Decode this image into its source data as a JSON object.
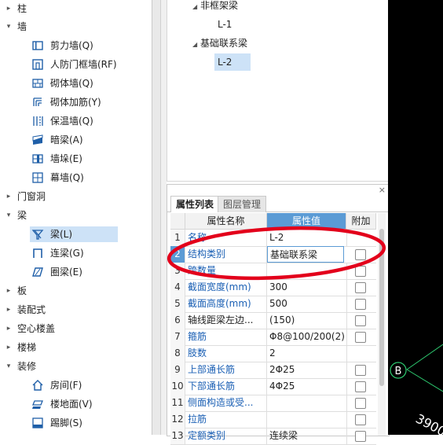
{
  "left_tree": {
    "categories": [
      {
        "label": "柱",
        "expanded": false
      },
      {
        "label": "墙",
        "expanded": true
      },
      {
        "label": "门窗洞",
        "expanded": false
      },
      {
        "label": "梁",
        "expanded": true
      },
      {
        "label": "板",
        "expanded": false
      },
      {
        "label": "装配式",
        "expanded": false
      },
      {
        "label": "空心楼盖",
        "expanded": false
      },
      {
        "label": "楼梯",
        "expanded": false
      },
      {
        "label": "装修",
        "expanded": true
      }
    ],
    "wall_items": [
      {
        "label": "剪力墙(Q)",
        "icon": "shear-wall-icon"
      },
      {
        "label": "人防门框墙(RF)",
        "icon": "civil-defense-door-wall-icon"
      },
      {
        "label": "砌体墙(Q)",
        "icon": "masonry-wall-icon"
      },
      {
        "label": "砌体加筋(Y)",
        "icon": "masonry-rebar-icon"
      },
      {
        "label": "保温墙(Q)",
        "icon": "insulation-wall-icon"
      },
      {
        "label": "暗梁(A)",
        "icon": "hidden-beam-icon"
      },
      {
        "label": "墙垛(E)",
        "icon": "wall-pier-icon"
      },
      {
        "label": "幕墙(Q)",
        "icon": "curtain-wall-icon"
      }
    ],
    "beam_items": [
      {
        "label": "梁(L)",
        "icon": "beam-icon",
        "selected": true
      },
      {
        "label": "连梁(G)",
        "icon": "coupling-beam-icon",
        "selected": false
      },
      {
        "label": "圈梁(E)",
        "icon": "ring-beam-icon",
        "selected": false
      }
    ],
    "decor_items": [
      {
        "label": "房间(F)",
        "icon": "room-icon"
      },
      {
        "label": "楼地面(V)",
        "icon": "floor-icon"
      },
      {
        "label": "踢脚(S)",
        "icon": "skirting-icon"
      }
    ]
  },
  "component_tree": {
    "group1": "非框架梁",
    "group1_leaf": "L-1",
    "group2": "基础联系梁",
    "group2_leaf": "L-2"
  },
  "props_panel": {
    "close_glyph": "×",
    "tabs": [
      "属性列表",
      "图层管理"
    ],
    "headers": {
      "name": "属性名称",
      "value": "属性值",
      "extra": "附加"
    },
    "rows": [
      {
        "n": "1",
        "name": "名称",
        "value": "L-2",
        "checkbox": false,
        "link": true
      },
      {
        "n": "2",
        "name": "结构类别",
        "value": "基础联系梁",
        "checkbox": true,
        "link": true,
        "editing": true
      },
      {
        "n": "3",
        "name": "跨数量",
        "value": "",
        "checkbox": true,
        "link": true
      },
      {
        "n": "4",
        "name": "截面宽度(mm)",
        "value": "300",
        "checkbox": true,
        "link": true
      },
      {
        "n": "5",
        "name": "截面高度(mm)",
        "value": "500",
        "checkbox": true,
        "link": true
      },
      {
        "n": "6",
        "name": "轴线距梁左边...",
        "value": "(150)",
        "checkbox": true,
        "link": false
      },
      {
        "n": "7",
        "name": "箍筋",
        "value": "Φ8@100/200(2)",
        "checkbox": true,
        "link": true
      },
      {
        "n": "8",
        "name": "肢数",
        "value": "2",
        "checkbox": false,
        "link": true
      },
      {
        "n": "9",
        "name": "上部通长筋",
        "value": "2Φ25",
        "checkbox": true,
        "link": true
      },
      {
        "n": "10",
        "name": "下部通长筋",
        "value": "4Φ25",
        "checkbox": true,
        "link": true
      },
      {
        "n": "11",
        "name": "侧面构造或受...",
        "value": "",
        "checkbox": true,
        "link": true
      },
      {
        "n": "12",
        "name": "拉筋",
        "value": "",
        "checkbox": true,
        "link": true
      },
      {
        "n": "13",
        "name": "定额类别",
        "value": "连续梁",
        "checkbox": true,
        "link": true
      }
    ]
  },
  "canvas": {
    "axis_label": "B",
    "dimension": "3900",
    "line_color": "#2ecc71"
  },
  "colors": {
    "selection": "#cde2f7",
    "header_accent": "#5b9bd5",
    "link_text": "#1a5fb4",
    "annotation": "#e3001b"
  }
}
